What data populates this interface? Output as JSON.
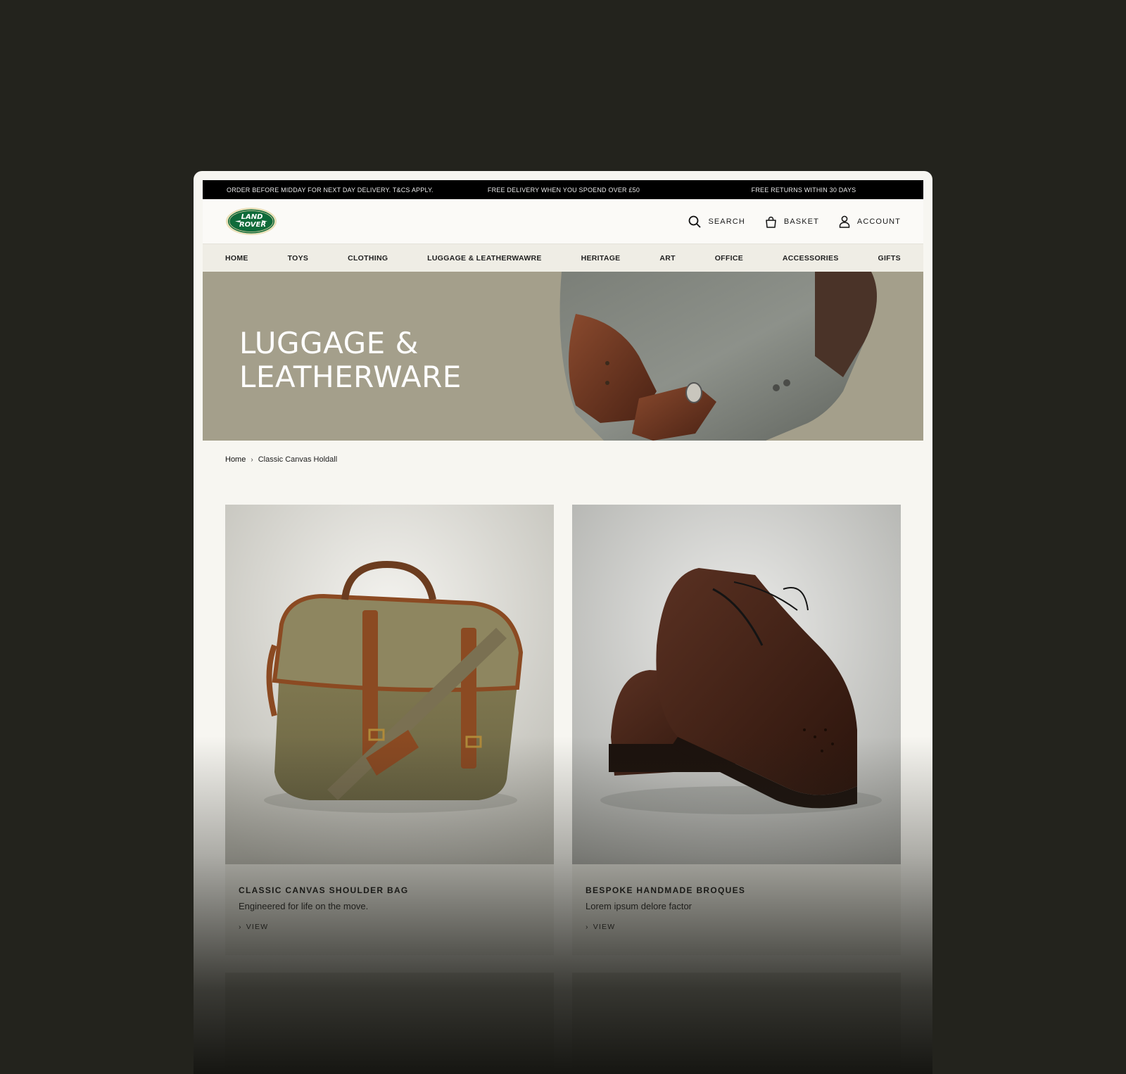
{
  "promo": {
    "item1": "ORDER BEFORE MIDDAY FOR NEXT DAY DELIVERY. T&CS APPLY.",
    "item2": "FREE DELIVERY WHEN YOU SPOEND OVER £50",
    "item3": "FREE RETURNS WITHIN 30 DAYS"
  },
  "brand": {
    "logo_text_1": "LAND",
    "logo_text_2": "ROVER",
    "logo_color": "#0f6b3a"
  },
  "header": {
    "search_label": "SEARCH",
    "basket_label": "BASKET",
    "account_label": "ACCOUNT"
  },
  "nav": {
    "items": [
      "HOME",
      "TOYS",
      "CLOTHING",
      "LUGGAGE & LEATHERWAWRE",
      "HERITAGE",
      "ART",
      "OFFICE",
      "ACCESSORIES",
      "GIFTS"
    ]
  },
  "hero": {
    "title_line1": "LUGGAGE &",
    "title_line2": "LEATHERWARE",
    "background_color": "#a49f8b"
  },
  "breadcrumb": {
    "home": "Home",
    "current": "Classic Canvas Holdall"
  },
  "products": [
    {
      "title": "CLASSIC CANVAS SHOULDER BAG",
      "desc": "Engineered for life on the move.",
      "link": "VIEW"
    },
    {
      "title": "BESPOKE HANDMADE BROQUES",
      "desc": "Lorem ipsum delore factor",
      "link": "VIEW"
    }
  ]
}
